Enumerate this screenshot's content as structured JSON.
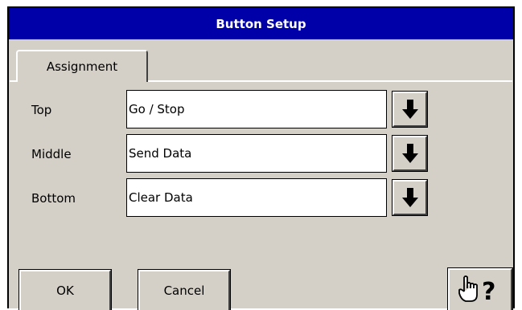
{
  "window": {
    "title": "Button Setup"
  },
  "tabs": [
    {
      "label": "Assignment",
      "active": true
    }
  ],
  "assignments": [
    {
      "label": "Top",
      "value": "Go / Stop"
    },
    {
      "label": "Middle",
      "value": "Send Data"
    },
    {
      "label": "Bottom",
      "value": "Clear Data"
    }
  ],
  "buttons": {
    "ok": "OK",
    "cancel": "Cancel"
  },
  "icons": {
    "dropdown": "down-arrow-icon",
    "help": "hand-pointer-help-icon"
  },
  "colors": {
    "titlebar": "#0000a8",
    "face": "#d4d0c8"
  }
}
